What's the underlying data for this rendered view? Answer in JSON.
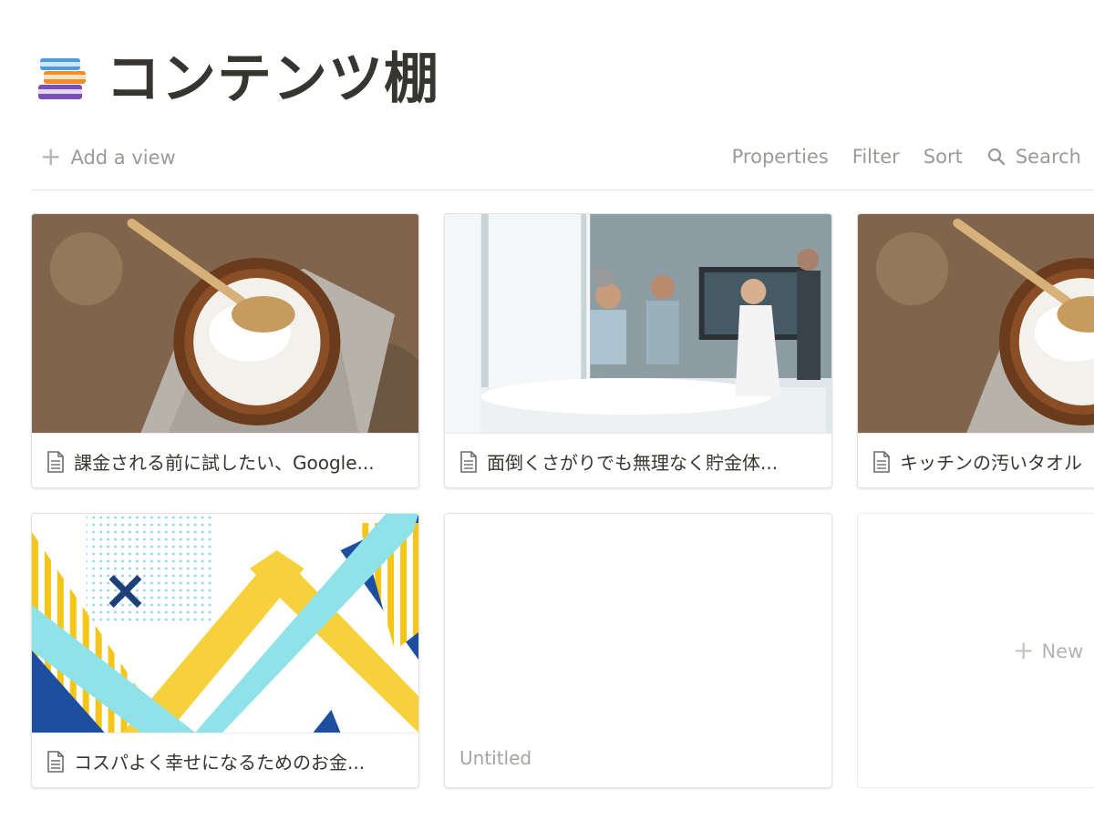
{
  "page": {
    "title": "コンテンツ棚",
    "icon": "books-icon"
  },
  "toolbar": {
    "add_view": "Add a view",
    "properties": "Properties",
    "filter": "Filter",
    "sort": "Sort",
    "search": "Search"
  },
  "cards": [
    {
      "title": "課金される前に試したい、Google...",
      "cover": "yogurt-bowl-photo"
    },
    {
      "title": "面倒くさがりでも無理なく貯金体...",
      "cover": "office-meeting-photo"
    },
    {
      "title": "キッチンの汚いタオル",
      "cover": "yogurt-bowl-photo"
    },
    {
      "title": "コスパよく幸せになるためのお金...",
      "cover": "geometric-pattern"
    },
    {
      "title": "Untitled",
      "cover": ""
    }
  ],
  "new_card": {
    "label": "New"
  },
  "colors": {
    "text": "#37352f",
    "muted": "#9b9a97",
    "border": "#e3e2df"
  }
}
